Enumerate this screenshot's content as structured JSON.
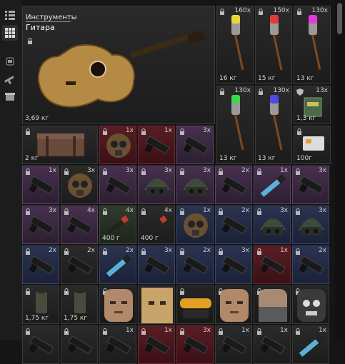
{
  "sidebar": {
    "buttons": [
      {
        "name": "list-view-icon"
      },
      {
        "name": "grid-view-icon"
      },
      {
        "name": "equipment-icon"
      },
      {
        "name": "weapon-icon"
      },
      {
        "name": "storage-icon"
      }
    ]
  },
  "featured": {
    "category": "Инструменты",
    "title": "Гитара",
    "weight": "3,69 кг"
  },
  "rockets": [
    {
      "count": "160x",
      "weight": "16 кг",
      "color": "#e6d63a"
    },
    {
      "count": "150x",
      "weight": "15 кг",
      "color": "#e23a3a"
    },
    {
      "count": "130x",
      "weight": "13 кг",
      "color": "#e23ad8"
    },
    {
      "count": "130x",
      "weight": "13 кг",
      "color": "#3ad84a"
    },
    {
      "count": "130x",
      "weight": "13 кг",
      "color": "#4a4ae6"
    }
  ],
  "book": {
    "count": "13x",
    "weight": "1,3 кг"
  },
  "card": {
    "weight": "100г"
  },
  "crate": {
    "weight": "2 кг"
  },
  "grid_rows": [
    [
      {
        "tone": "red",
        "type": "mask",
        "count": "1x"
      },
      {
        "tone": "red",
        "type": "gun",
        "count": "1x"
      },
      {
        "tone": "purple",
        "type": "gun",
        "count": "3x"
      }
    ],
    [
      {
        "tone": "purple",
        "type": "gun",
        "count": "1x"
      },
      {
        "tone": "neutral",
        "type": "mask",
        "count": "3x"
      },
      {
        "tone": "purple",
        "type": "gun",
        "count": "3x"
      },
      {
        "tone": "purple",
        "type": "helmet",
        "count": "3x"
      },
      {
        "tone": "purple",
        "type": "helmet",
        "count": "3x"
      },
      {
        "tone": "purple",
        "type": "gun",
        "count": "2x"
      },
      {
        "tone": "purple",
        "type": "blade",
        "count": "1x"
      },
      {
        "tone": "purple",
        "type": "gun",
        "count": "3x"
      }
    ],
    [
      {
        "tone": "purple",
        "type": "gun",
        "count": "3x"
      },
      {
        "tone": "purple",
        "type": "gun",
        "count": "4x"
      },
      {
        "tone": "green",
        "type": "lighter",
        "count": "4x",
        "weight": "400 г"
      },
      {
        "tone": "neutral",
        "type": "lighter",
        "count": "4x",
        "weight": "400 г"
      },
      {
        "tone": "blue",
        "type": "mask",
        "count": "1x"
      },
      {
        "tone": "blue",
        "type": "gun",
        "count": "2x"
      },
      {
        "tone": "blue",
        "type": "helmet",
        "count": "3x"
      },
      {
        "tone": "blue",
        "type": "helmet",
        "count": "3x"
      }
    ],
    [
      {
        "tone": "blue",
        "type": "gun",
        "count": "2x"
      },
      {
        "tone": "neutral",
        "type": "gun",
        "count": "2x"
      },
      {
        "tone": "blue",
        "type": "blade",
        "count": "2x"
      },
      {
        "tone": "blue",
        "type": "gun",
        "count": "3x"
      },
      {
        "tone": "blue",
        "type": "gun",
        "count": "2x"
      },
      {
        "tone": "blue",
        "type": "gun",
        "count": "3x"
      },
      {
        "tone": "red",
        "type": "gun",
        "count": "1x"
      },
      {
        "tone": "blue",
        "type": "gun",
        "count": "2x"
      }
    ],
    [
      {
        "tone": "neutral",
        "type": "tall",
        "count": "",
        "weight": "1,75 кг"
      },
      {
        "tone": "neutral",
        "type": "tall",
        "count": "",
        "weight": "1,75 кг"
      },
      {
        "tone": "dark",
        "type": "face",
        "count": ""
      },
      {
        "tone": "dark",
        "type": "sack",
        "count": ""
      },
      {
        "tone": "dark",
        "type": "goggles",
        "count": ""
      },
      {
        "tone": "dark",
        "type": "face",
        "count": ""
      },
      {
        "tone": "dark",
        "type": "scarf",
        "count": ""
      },
      {
        "tone": "dark",
        "type": "skull",
        "count": ""
      }
    ],
    [
      {
        "tone": "neutral",
        "type": "gun",
        "count": ""
      },
      {
        "tone": "neutral",
        "type": "gun",
        "count": ""
      },
      {
        "tone": "neutral",
        "type": "gun",
        "count": "1x"
      },
      {
        "tone": "red",
        "type": "gun",
        "count": "1x"
      },
      {
        "tone": "red",
        "type": "gun",
        "count": "3x"
      },
      {
        "tone": "neutral",
        "type": "gun",
        "count": "1x"
      },
      {
        "tone": "neutral",
        "type": "gun",
        "count": "1x"
      },
      {
        "tone": "neutral",
        "type": "blade",
        "count": "1x"
      }
    ]
  ]
}
